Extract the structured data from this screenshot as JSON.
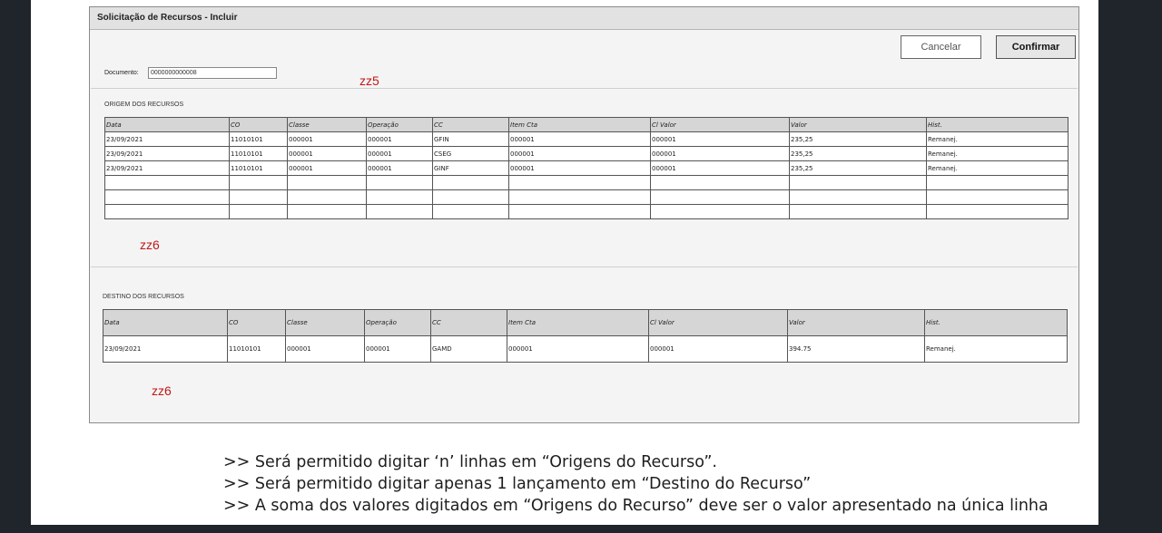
{
  "window": {
    "title": "Solicitação de Recursos - Incluir",
    "cancel_label": "Cancelar",
    "confirm_label": "Confirmar"
  },
  "documento": {
    "label": "Documento:",
    "value": "0000000000008"
  },
  "annotations": {
    "zz5": "zz5",
    "zz6_origem": "zz6",
    "zz6_destino": "zz6"
  },
  "origem": {
    "label": "ORIGEM DOS RECURSOS",
    "columns": [
      "Data",
      "CO",
      "Classe",
      "Operação",
      "CC",
      "Item Cta",
      "Cl Valor",
      "Valor",
      "Hist."
    ],
    "rows": [
      [
        "23/09/2021",
        "11010101",
        "000001",
        "000001",
        "GFIN",
        "000001",
        "000001",
        "235,25",
        "Remanej."
      ],
      [
        "23/09/2021",
        "11010101",
        "000001",
        "000001",
        "CSEG",
        "000001",
        "000001",
        "235,25",
        "Remanej."
      ],
      [
        "23/09/2021",
        "11010101",
        "000001",
        "000001",
        "GINF",
        "000001",
        "000001",
        "235,25",
        "Remanej."
      ],
      [
        "",
        "",
        "",
        "",
        "",
        "",
        "",
        "",
        ""
      ],
      [
        "",
        "",
        "",
        "",
        "",
        "",
        "",
        "",
        ""
      ],
      [
        "",
        "",
        "",
        "",
        "",
        "",
        "",
        "",
        ""
      ]
    ]
  },
  "destino": {
    "label": "DESTINO DOS RECURSOS",
    "columns": [
      "Data",
      "CO",
      "Classe",
      "Operação",
      "CC",
      "Item Cta",
      "Cl Valor",
      "Valor",
      "Hist."
    ],
    "rows": [
      [
        "23/09/2021",
        "11010101",
        "000001",
        "000001",
        "GAMD",
        "000001",
        "000001",
        "394.75",
        "Remanej."
      ]
    ]
  },
  "notes": [
    ">> Será permitido digitar ‘n’ linhas em “Origens do Recurso”.",
    ">> Será permitido digitar apenas 1 lançamento em “Destino do Recurso”",
    ">> A soma dos valores digitados em “Origens do Recurso” deve ser o valor apresentado na única linha"
  ]
}
